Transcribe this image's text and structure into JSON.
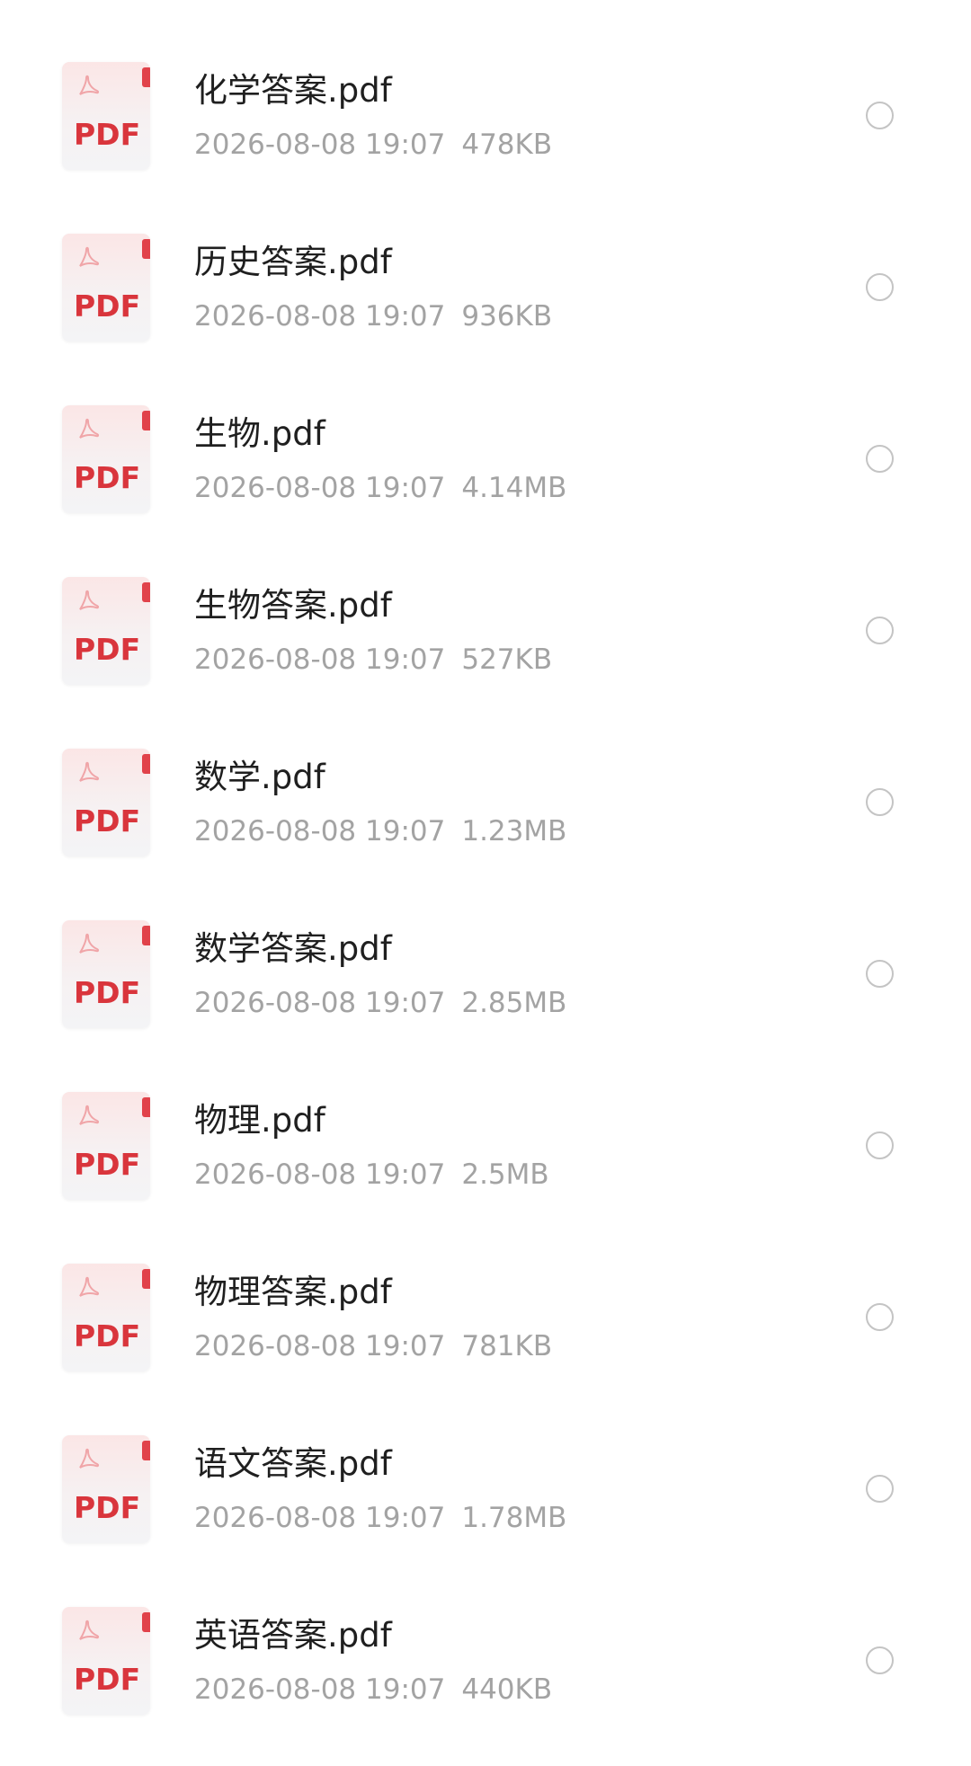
{
  "files": [
    {
      "name": "化学答案.pdf",
      "date": "2026-08-08 19:07",
      "size": "478KB",
      "icon_label": "PDF"
    },
    {
      "name": "历史答案.pdf",
      "date": "2026-08-08 19:07",
      "size": "936KB",
      "icon_label": "PDF"
    },
    {
      "name": "生物.pdf",
      "date": "2026-08-08 19:07",
      "size": "4.14MB",
      "icon_label": "PDF"
    },
    {
      "name": "生物答案.pdf",
      "date": "2026-08-08 19:07",
      "size": "527KB",
      "icon_label": "PDF"
    },
    {
      "name": "数学.pdf",
      "date": "2026-08-08 19:07",
      "size": "1.23MB",
      "icon_label": "PDF"
    },
    {
      "name": "数学答案.pdf",
      "date": "2026-08-08 19:07",
      "size": "2.85MB",
      "icon_label": "PDF"
    },
    {
      "name": "物理.pdf",
      "date": "2026-08-08 19:07",
      "size": "2.5MB",
      "icon_label": "PDF"
    },
    {
      "name": "物理答案.pdf",
      "date": "2026-08-08 19:07",
      "size": "781KB",
      "icon_label": "PDF"
    },
    {
      "name": "语文答案.pdf",
      "date": "2026-08-08 19:07",
      "size": "1.78MB",
      "icon_label": "PDF"
    },
    {
      "name": "英语答案.pdf",
      "date": "2026-08-08 19:07",
      "size": "440KB",
      "icon_label": "PDF"
    }
  ],
  "icons": {
    "file_type": "pdf-file-icon",
    "select": "radio-unchecked-icon"
  },
  "colors": {
    "pdf_red": "#d9353c",
    "accent_fold": "#e1424a",
    "name_text": "#1f1f1f",
    "meta_text": "#a3a3a3",
    "radio_border": "#c4c4c4"
  }
}
